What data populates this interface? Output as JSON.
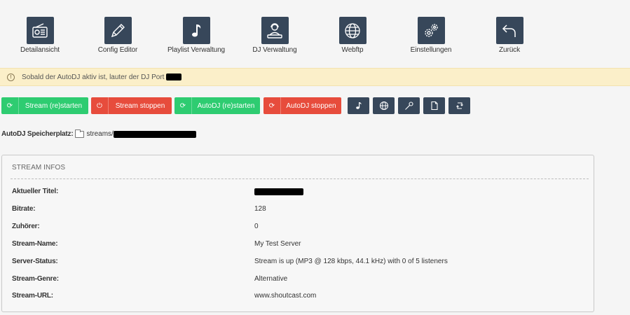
{
  "tiles": [
    {
      "label": "Detailansicht",
      "icon": "radio-icon"
    },
    {
      "label": "Config Editor",
      "icon": "pencil-icon"
    },
    {
      "label": "Playlist Verwaltung",
      "icon": "music-note-icon"
    },
    {
      "label": "DJ Verwaltung",
      "icon": "dj-icon"
    },
    {
      "label": "Webftp",
      "icon": "globe-icon"
    },
    {
      "label": "Einstellungen",
      "icon": "gears-icon"
    },
    {
      "label": "Zurück",
      "icon": "undo-icon"
    }
  ],
  "alert": {
    "text": "Sobald der AutoDJ aktiv ist, lauter der DJ Port",
    "icon": "info-icon"
  },
  "actions": {
    "stream_restart": "Stream (re)starten",
    "stream_stop": "Stream stoppen",
    "autodj_restart": "AutoDJ (re)starten",
    "autodj_stop": "AutoDJ stoppen",
    "icon_buttons": [
      "music-note-icon",
      "globe-icon",
      "microphone-icon",
      "file-icon",
      "refresh-icon"
    ]
  },
  "storage": {
    "label": "AutoDJ Speicherplatz:",
    "path": "streams/"
  },
  "stream_info": {
    "heading": "STREAM INFOS",
    "rows": [
      {
        "key": "Aktueller Titel:",
        "value": ""
      },
      {
        "key": "Bitrate:",
        "value": "128"
      },
      {
        "key": "Zuhörer:",
        "value": "0"
      },
      {
        "key": "Stream-Name:",
        "value": "My Test Server"
      },
      {
        "key": "Server-Status:",
        "value": "Stream is up (MP3 @ 128 kbps, 44.1 kHz) with 0 of 5 listeners"
      },
      {
        "key": "Stream-Genre:",
        "value": "Alternative"
      },
      {
        "key": "Stream-URL:",
        "value": "www.shoutcast.com"
      }
    ]
  },
  "colors": {
    "tile_bg": "#37475a",
    "green": "#2ecc71",
    "red": "#e74c3c",
    "alert_bg": "#fbefc9"
  }
}
